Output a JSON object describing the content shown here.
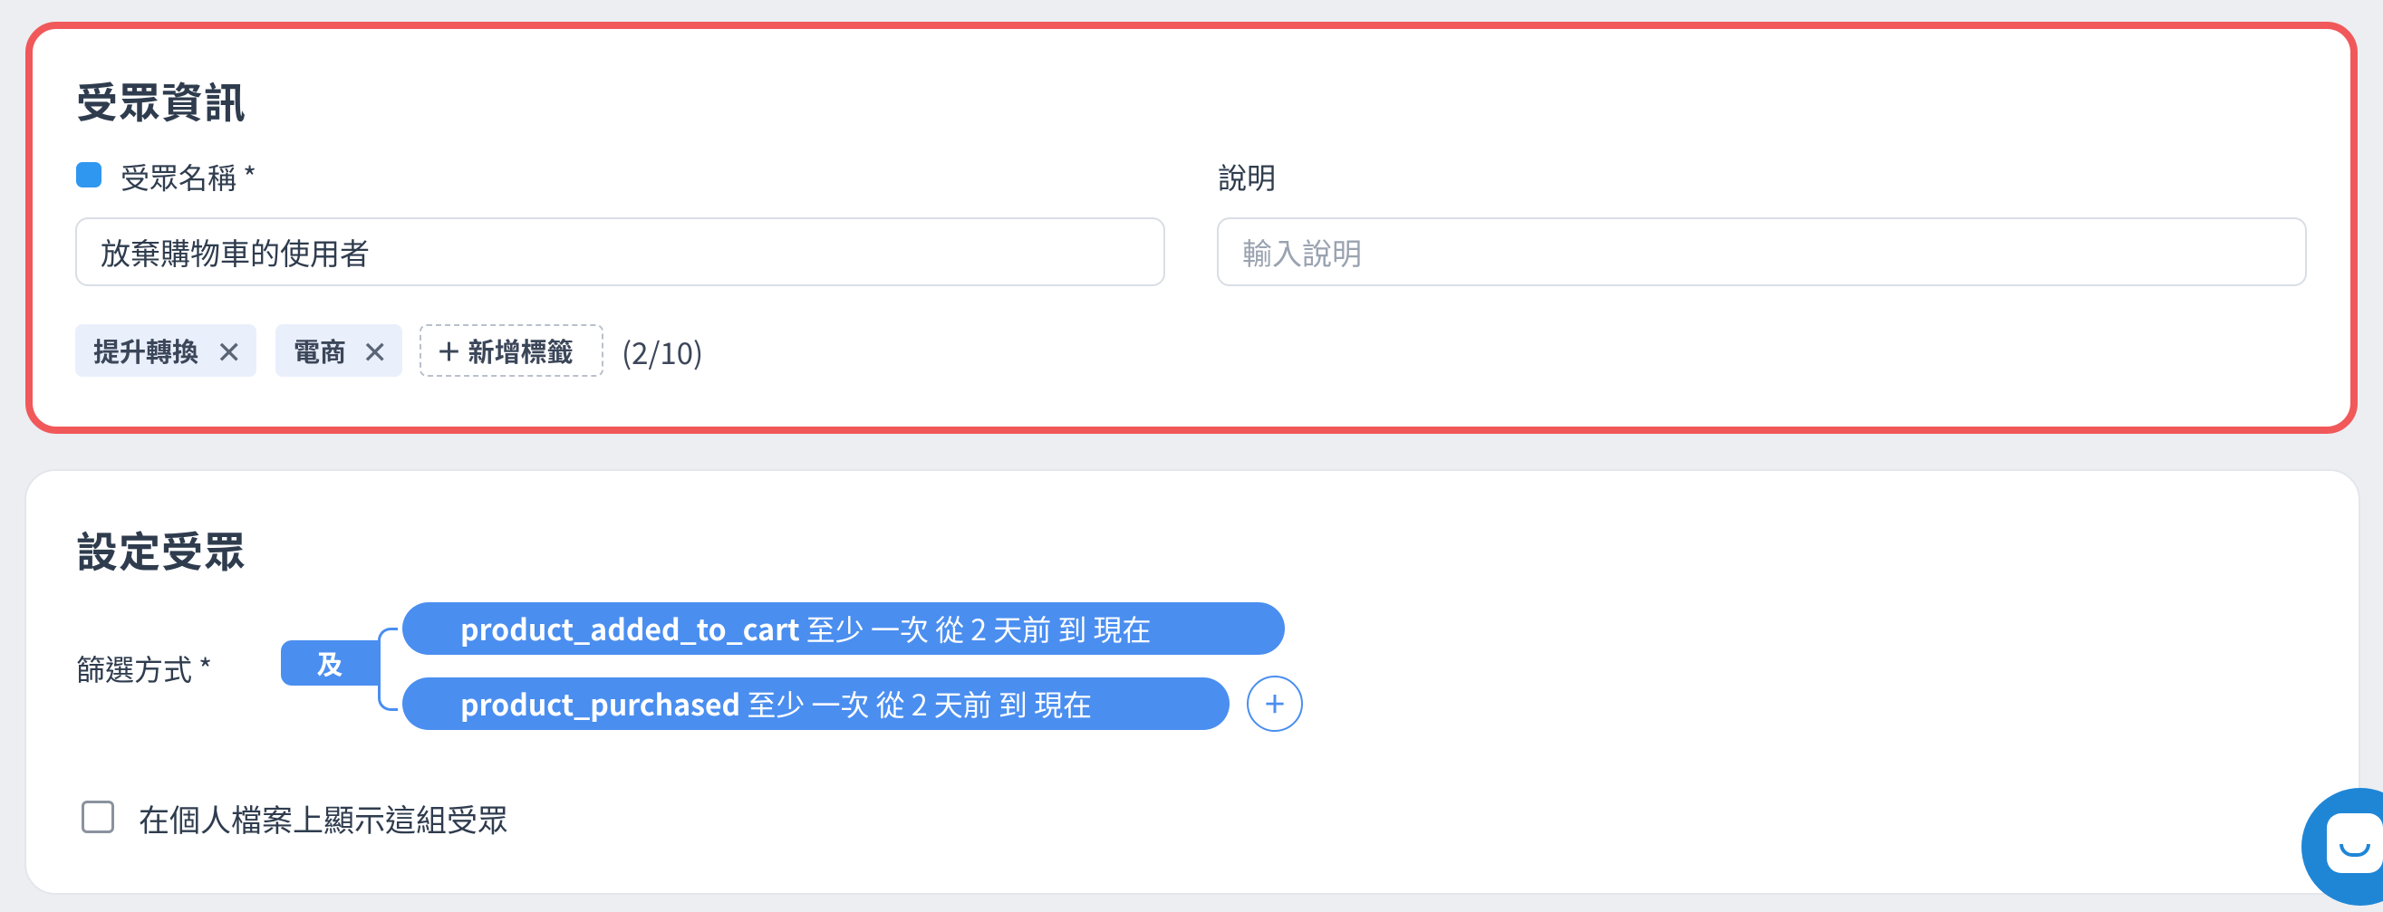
{
  "audience_info": {
    "title": "受眾資訊",
    "name_label": "受眾名稱 *",
    "name_value": "放棄購物車的使用者",
    "description_label": "說明",
    "description_placeholder": "輸入說明",
    "tags": [
      {
        "label": "提升轉換"
      },
      {
        "label": "電商"
      }
    ],
    "add_tag_label": "＋  新增標籤",
    "tag_count": "(2/10)"
  },
  "audience_setup": {
    "title": "設定受眾",
    "filter_label": "篩選方式 *",
    "logic_operator": "及",
    "conditions": [
      {
        "event": "product_added_to_cart",
        "rule": " 至少 一次 從 2 天前 到 現在"
      },
      {
        "event": "product_purchased",
        "rule": " 至少 一次 從 2 天前 到 現在"
      }
    ],
    "add_condition": "+",
    "show_on_profile_label": "在個人檔案上顯示這組受眾"
  },
  "icons": {
    "tag_remove": "close-icon",
    "add_condition": "plus-icon",
    "chat": "chat-icon"
  },
  "colors": {
    "highlight_border": "#f1585a",
    "accent": "#4a8ef0",
    "color_marker": "#2f97ef"
  }
}
